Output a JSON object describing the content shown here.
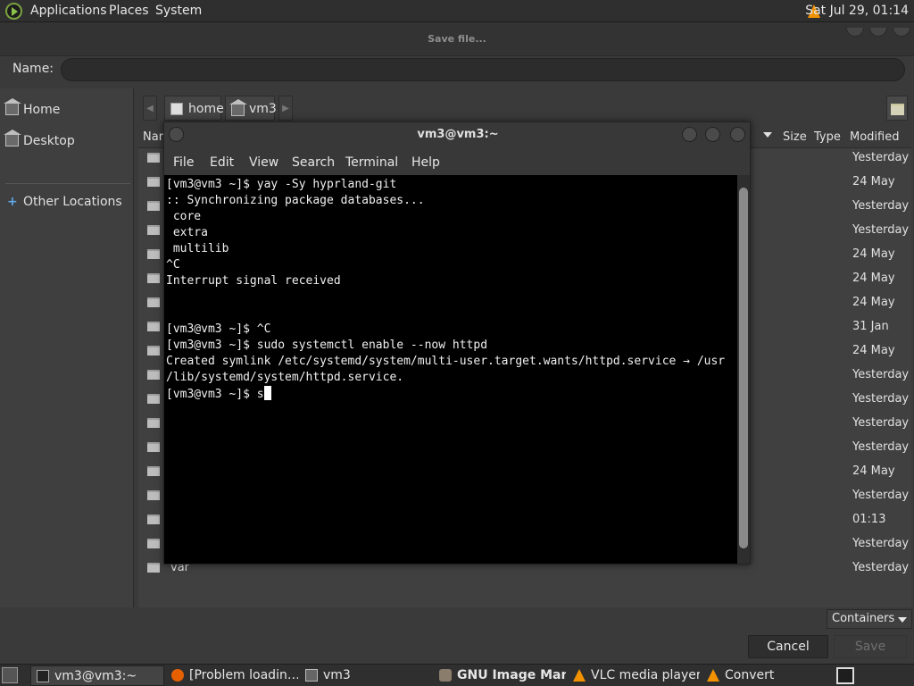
{
  "top_panel": {
    "menus": [
      "Applications",
      "Places",
      "System"
    ],
    "clock": "Sat Jul 29, 01:14"
  },
  "dialog": {
    "title": "Save file...",
    "name_label": "Name:",
    "name_value": "",
    "places": {
      "home": "Home",
      "desktop": "Desktop",
      "other": "Other Locations"
    },
    "path": [
      "home",
      "vm3"
    ],
    "columns": {
      "name": "Nar",
      "size": "Size",
      "type": "Type",
      "modified": "Modified"
    },
    "rows": [
      {
        "name": "",
        "modified": "Yesterday"
      },
      {
        "name": "",
        "modified": "24 May"
      },
      {
        "name": "",
        "modified": "Yesterday"
      },
      {
        "name": "",
        "modified": "Yesterday"
      },
      {
        "name": "",
        "modified": "24 May"
      },
      {
        "name": "",
        "modified": "24 May"
      },
      {
        "name": "",
        "modified": "24 May"
      },
      {
        "name": "",
        "modified": "31 Jan"
      },
      {
        "name": "",
        "modified": "24 May"
      },
      {
        "name": "",
        "modified": "Yesterday"
      },
      {
        "name": "",
        "modified": "Yesterday"
      },
      {
        "name": "",
        "modified": "Yesterday"
      },
      {
        "name": "",
        "modified": "Yesterday"
      },
      {
        "name": "",
        "modified": "24 May"
      },
      {
        "name": "",
        "modified": "Yesterday"
      },
      {
        "name": "",
        "modified": "01:13"
      },
      {
        "name": "",
        "modified": "Yesterday"
      },
      {
        "name": "var",
        "modified": "Yesterday"
      }
    ],
    "containers_label": "Containers",
    "cancel_label": "Cancel",
    "save_label": "Save"
  },
  "terminal": {
    "title": "vm3@vm3:~",
    "menus": [
      "File",
      "Edit",
      "View",
      "Search",
      "Terminal",
      "Help"
    ],
    "lines": [
      "[vm3@vm3 ~]$ yay -Sy hyprland-git",
      ":: Synchronizing package databases...",
      " core",
      " extra",
      " multilib",
      "^C",
      "Interrupt signal received",
      "",
      "",
      "[vm3@vm3 ~]$ ^C",
      "[vm3@vm3 ~]$ sudo systemctl enable --now httpd",
      "Created symlink /etc/systemd/system/multi-user.target.wants/httpd.service → /usr",
      "/lib/systemd/system/httpd.service."
    ],
    "prompt": "[vm3@vm3 ~]$ s"
  },
  "taskbar": {
    "tasks": [
      {
        "label": "vm3@vm3:~",
        "icon": "terminal-icon"
      },
      {
        "label": "[Problem loadin…",
        "icon": "firefox-icon"
      },
      {
        "label": "vm3",
        "icon": "home-folder-icon"
      },
      {
        "label": "GNU Image Man…",
        "icon": "gimp-icon"
      },
      {
        "label": "VLC media player",
        "icon": "vlc-icon"
      },
      {
        "label": "Convert",
        "icon": "vlc-icon"
      }
    ]
  },
  "colors": {
    "panel": "#2f2f2f",
    "dialog": "#3a3a3a",
    "terminal_bg": "#000000",
    "accent_blue": "#5fa8e8",
    "vlc_orange": "#f39200"
  }
}
